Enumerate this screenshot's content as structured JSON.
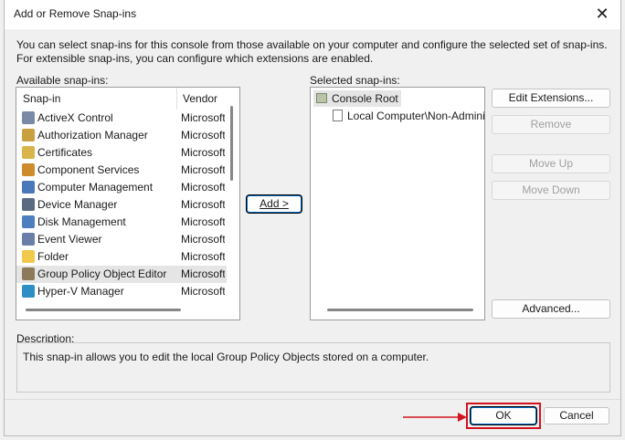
{
  "window": {
    "title": "Add or Remove Snap-ins",
    "close_glyph": "✕"
  },
  "intro_text": "You can select snap-ins for this console from those available on your computer and configure the selected set of snap-ins. For extensible snap-ins, you can configure which extensions are enabled.",
  "available": {
    "label": "Available snap-ins:",
    "col_snapin": "Snap-in",
    "col_vendor": "Vendor",
    "items": [
      {
        "name": "ActiveX Control",
        "vendor": "Microsoft",
        "icon": "activex-icon",
        "color": "#7a8aa6"
      },
      {
        "name": "Authorization Manager",
        "vendor": "Microsoft",
        "icon": "authorization-manager-icon",
        "color": "#c8a040"
      },
      {
        "name": "Certificates",
        "vendor": "Microsoft",
        "icon": "certificates-icon",
        "color": "#d9b44a"
      },
      {
        "name": "Component Services",
        "vendor": "Microsoft",
        "icon": "component-services-icon",
        "color": "#d08a2e"
      },
      {
        "name": "Computer Management",
        "vendor": "Microsoft",
        "icon": "computer-management-icon",
        "color": "#4a78b8"
      },
      {
        "name": "Device Manager",
        "vendor": "Microsoft",
        "icon": "device-manager-icon",
        "color": "#5a6a80"
      },
      {
        "name": "Disk Management",
        "vendor": "Microsoft",
        "icon": "disk-management-icon",
        "color": "#4d7fc0"
      },
      {
        "name": "Event Viewer",
        "vendor": "Microsoft",
        "icon": "event-viewer-icon",
        "color": "#6a7fa8"
      },
      {
        "name": "Folder",
        "vendor": "Microsoft",
        "icon": "folder-icon",
        "color": "#f2c94c"
      },
      {
        "name": "Group Policy Object Editor",
        "vendor": "Microsoft",
        "icon": "group-policy-icon",
        "color": "#8c7a5a"
      },
      {
        "name": "Hyper-V Manager",
        "vendor": "Microsoft",
        "icon": "hyperv-manager-icon",
        "color": "#2d8fc4"
      }
    ]
  },
  "selected": {
    "label": "Selected snap-ins:",
    "root": "Console Root",
    "child": "Local Computer\\Non-Administrators Policy"
  },
  "buttons": {
    "add": "Add >",
    "edit_extensions": "Edit Extensions...",
    "remove": "Remove",
    "move_up": "Move Up",
    "move_down": "Move Down",
    "advanced": "Advanced...",
    "ok": "OK",
    "cancel": "Cancel"
  },
  "description": {
    "label": "Description:",
    "text": "This snap-in allows you to edit the local Group Policy Objects stored on a computer."
  },
  "colors": {
    "highlight_box": "#d3131f",
    "arrow": "#d3131f",
    "focus_border": "#0067c0"
  }
}
